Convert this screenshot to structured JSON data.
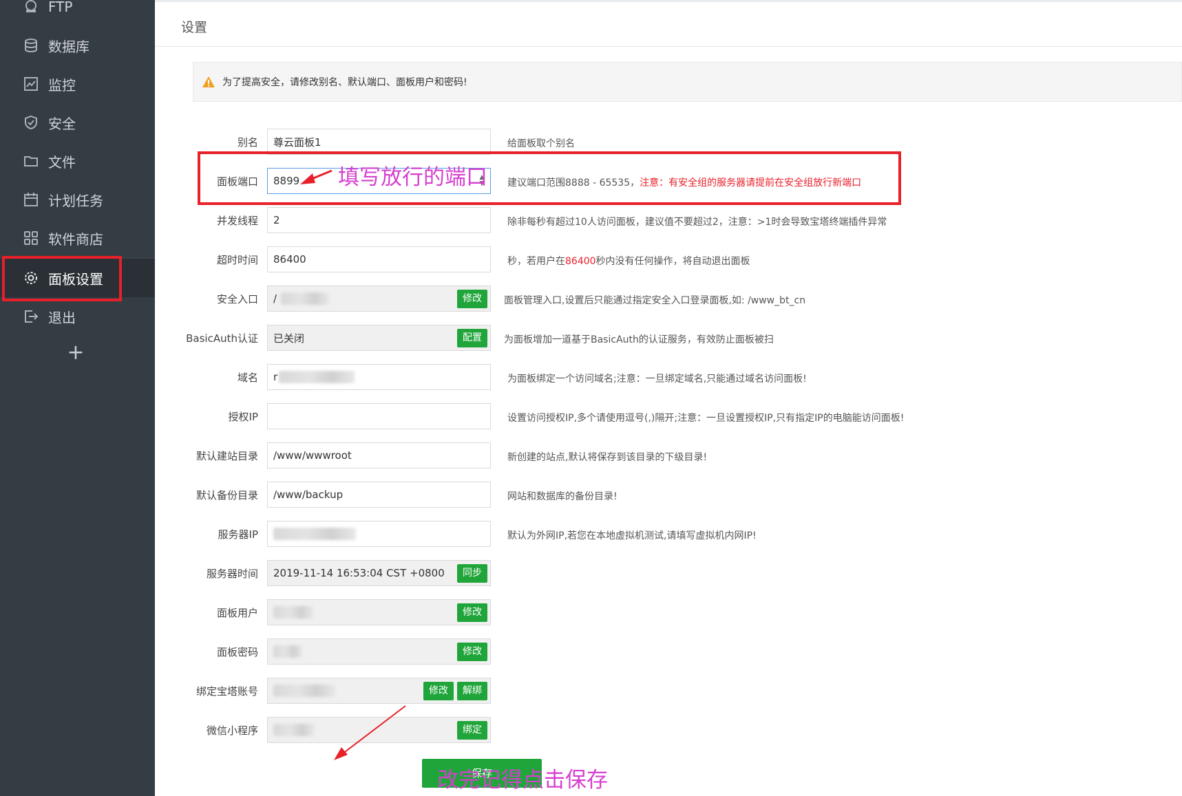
{
  "sidebar": {
    "items": [
      {
        "label": "FTP",
        "icon": "ftp-icon"
      },
      {
        "label": "数据库",
        "icon": "database-icon"
      },
      {
        "label": "监控",
        "icon": "monitor-icon"
      },
      {
        "label": "安全",
        "icon": "shield-icon"
      },
      {
        "label": "文件",
        "icon": "folder-icon"
      },
      {
        "label": "计划任务",
        "icon": "calendar-icon"
      },
      {
        "label": "软件商店",
        "icon": "grid-icon"
      },
      {
        "label": "面板设置",
        "icon": "gear-icon"
      },
      {
        "label": "退出",
        "icon": "logout-icon"
      }
    ],
    "active": "面板设置",
    "add_label": "+"
  },
  "header": {
    "title": "设置"
  },
  "alert": {
    "text": "为了提高安全，请修改别名、默认端口、面板用户和密码!"
  },
  "form": {
    "alias": {
      "label": "别名",
      "value": "尊云面板1",
      "hint": "给面板取个别名"
    },
    "port": {
      "label": "面板端口",
      "value": "8899",
      "hint": "建议端口范围8888 - 65535，",
      "hint_red": "注意：有安全组的服务器请提前在安全组放行新端口"
    },
    "threads": {
      "label": "并发线程",
      "value": "2",
      "hint": "除非每秒有超过10人访问面板，建议值不要超过2，注意：>1时会导致宝塔终端插件异常"
    },
    "timeout": {
      "label": "超时时间",
      "value": "86400",
      "hint_a": "秒，若用户在",
      "hint_red": "86400",
      "hint_b": "秒内没有任何操作，将自动退出面板"
    },
    "entry": {
      "label": "安全入口",
      "value": "/",
      "button": "修改",
      "hint": "面板管理入口,设置后只能通过指定安全入口登录面板,如: /www_bt_cn"
    },
    "basicauth": {
      "label": "BasicAuth认证",
      "value": "已关闭",
      "button": "配置",
      "hint": "为面板增加一道基于BasicAuth的认证服务，有效防止面板被扫"
    },
    "domain": {
      "label": "域名",
      "value": "r",
      "hint": "为面板绑定一个访问域名;注意：一旦绑定域名,只能通过域名访问面板!"
    },
    "authip": {
      "label": "授权IP",
      "value": "",
      "hint": "设置访问授权IP,多个请使用逗号(,)隔开;注意：一旦设置授权IP,只有指定IP的电脑能访问面板!"
    },
    "siteroot": {
      "label": "默认建站目录",
      "value": "/www/wwwroot",
      "hint": "新创建的站点,默认将保存到该目录的下级目录!"
    },
    "backup": {
      "label": "默认备份目录",
      "value": "/www/backup",
      "hint": "网站和数据库的备份目录!"
    },
    "serverip": {
      "label": "服务器IP",
      "value": "",
      "hint": "默认为外网IP,若您在本地虚拟机测试,请填写虚拟机内网IP!"
    },
    "servertime": {
      "label": "服务器时间",
      "value": "2019-11-14 16:53:04 CST +0800",
      "button": "同步"
    },
    "user": {
      "label": "面板用户",
      "button": "修改"
    },
    "password": {
      "label": "面板密码",
      "button": "修改"
    },
    "btaccount": {
      "label": "绑定宝塔账号",
      "button1": "修改",
      "button2": "解绑"
    },
    "wechat": {
      "label": "微信小程序",
      "button": "绑定"
    },
    "save_label": "保存"
  },
  "annotations": {
    "port_note": "填写放行的端口",
    "save_note": "改完记得点击保存"
  },
  "colors": {
    "sidebar_bg": "#353d44",
    "accent_green": "#20a53a",
    "annotation_red": "#e8202a",
    "annotation_magenta": "#d63fcf"
  }
}
